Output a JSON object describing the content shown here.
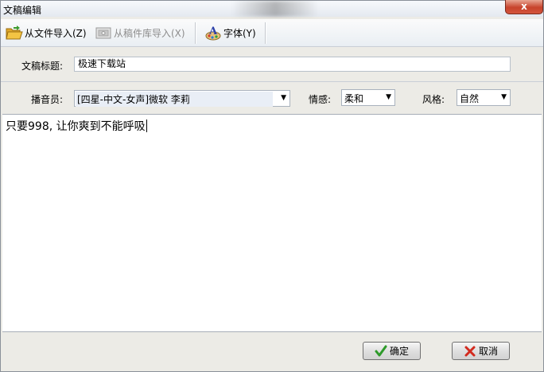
{
  "window": {
    "title": "文稿编辑",
    "close_label": "x"
  },
  "toolbar": {
    "import_file": "从文件导入(Z)",
    "import_library": "从稿件库导入(X)",
    "font": "字体(Y)"
  },
  "form": {
    "title_label": "文稿标题:",
    "title_value": "极速下载站",
    "announcer_label": "播音员:",
    "announcer_value": "[四星-中文-女声]微软 李莉",
    "emotion_label": "情感:",
    "emotion_value": "柔和",
    "style_label": "风格:",
    "style_value": "自然"
  },
  "editor": {
    "text": "只要998, 让你爽到不能呼吸"
  },
  "buttons": {
    "ok": "确定",
    "cancel": "取消"
  },
  "colors": {
    "ok_check": "#2e9a2a",
    "cancel_x": "#d22a1e",
    "folder": "#f3c443"
  }
}
